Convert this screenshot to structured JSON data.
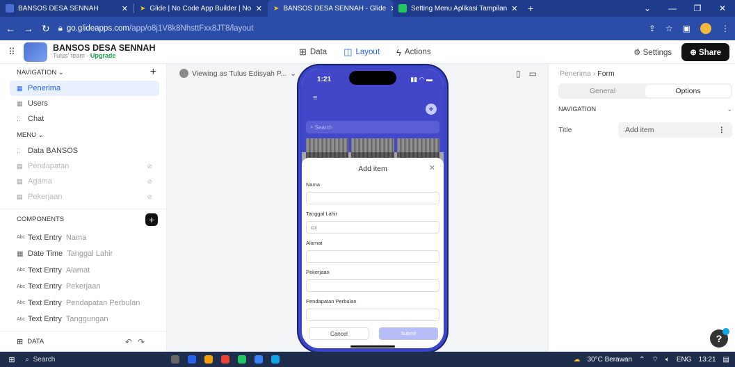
{
  "browser": {
    "tabs": [
      {
        "title": "BANSOS DESA SENNAH",
        "color": "#4a6fd1"
      },
      {
        "title": "Glide | No Code App Builder | No",
        "color": "#fbbf24"
      },
      {
        "title": "BANSOS DESA SENNAH - Glide",
        "color": "#fbbf24"
      },
      {
        "title": "Setting Menu Aplikasi Tampilan",
        "color": "#22c55e"
      }
    ],
    "url_host": "go.glideapps.com",
    "url_path": "/app/o8j1V8k8NhsttFxx8JT8/layout"
  },
  "app": {
    "name": "BANSOS DESA SENNAH",
    "team": "Tulus' team · ",
    "upgrade": "Upgrade",
    "modes": [
      "Data",
      "Layout",
      "Actions"
    ],
    "settings": "Settings",
    "share": "Share"
  },
  "sidebar": {
    "navigation_label": "NAVIGATION",
    "nav_items": [
      "Penerima",
      "Users",
      "Chat"
    ],
    "menu_label": "MENU",
    "menu_items": [
      "Data BANSOS",
      "Pendapatan",
      "Agama",
      "Pekerjaan"
    ],
    "components_label": "COMPONENTS",
    "components": [
      {
        "type": "Text Entry",
        "name": "Nama"
      },
      {
        "type": "Date Time",
        "name": "Tanggal Lahir"
      },
      {
        "type": "Text Entry",
        "name": "Alamat"
      },
      {
        "type": "Text Entry",
        "name": "Pekerjaan"
      },
      {
        "type": "Text Entry",
        "name": "Pendapatan Perbulan"
      },
      {
        "type": "Text Entry",
        "name": "Tanggungan"
      }
    ],
    "data_label": "DATA"
  },
  "canvas": {
    "viewing_as": "Viewing as Tulus Edisyah P...",
    "phone": {
      "time": "1:21",
      "search_placeholder": "Search",
      "sheet_title": "Add item",
      "fields": [
        "Nama",
        "Tanggal Lahir",
        "Alamat",
        "Pekerjaan",
        "Pendapatan Perbulan"
      ],
      "cancel": "Cancel",
      "submit": "Submit"
    }
  },
  "right_panel": {
    "crumb_parent": "Penerima",
    "crumb_sep": "›",
    "crumb_current": "Form",
    "tabs": [
      "General",
      "Options"
    ],
    "navigation_label": "NAVIGATION",
    "title_label": "Title",
    "title_value": "Add item"
  },
  "taskbar": {
    "search": "Search",
    "weather": "30°C Berawan",
    "lang": "ENG",
    "clock": "13:21"
  }
}
